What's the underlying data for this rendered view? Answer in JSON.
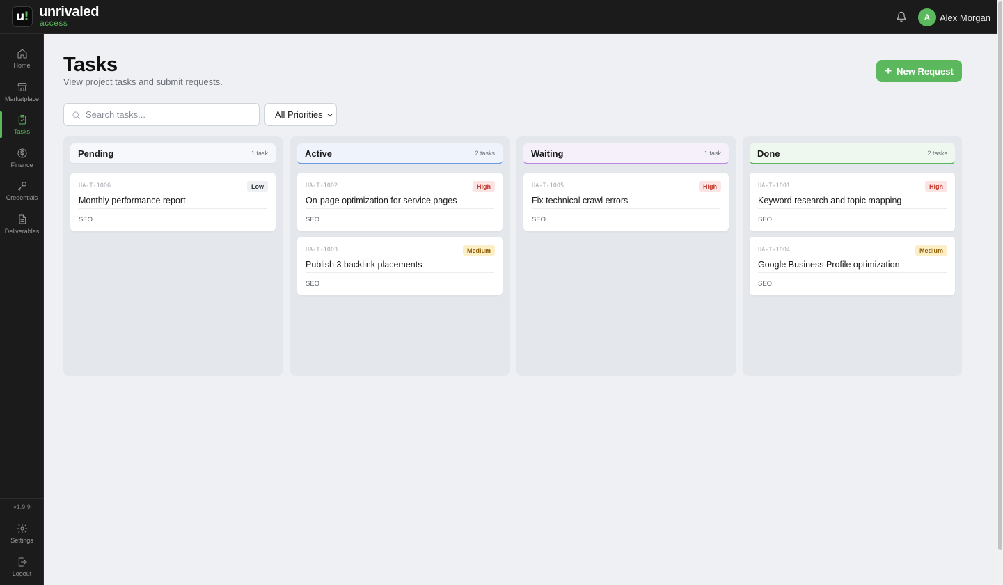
{
  "app": {
    "logo_mark": "u",
    "logo_mark_accent": "!",
    "name": "unrivaled",
    "sub": "access",
    "accent": "#5cb85c"
  },
  "user": {
    "initial": "A",
    "name": "Alex Morgan"
  },
  "sidebar": {
    "items": [
      {
        "label": "Home",
        "icon": "home-icon"
      },
      {
        "label": "Marketplace",
        "icon": "store-icon"
      },
      {
        "label": "Tasks",
        "icon": "clipboard-check-icon",
        "active": true
      },
      {
        "label": "Finance",
        "icon": "dollar-circle-icon"
      },
      {
        "label": "Credentials",
        "icon": "key-icon"
      },
      {
        "label": "Deliverables",
        "icon": "document-icon"
      }
    ],
    "version": "v1.9.9",
    "bottom": [
      {
        "label": "Settings",
        "icon": "gear-icon"
      },
      {
        "label": "Logout",
        "icon": "logout-icon"
      }
    ]
  },
  "page": {
    "title": "Tasks",
    "subtitle": "View project tasks and submit requests.",
    "new_request_label": "New Request"
  },
  "filters": {
    "search_placeholder": "Search tasks...",
    "priority_selected": "All Priorities"
  },
  "columns": [
    {
      "title": "Pending",
      "count": "1 task",
      "cards": [
        {
          "id": "UA-T-1006",
          "title": "Monthly performance report",
          "priority": "Low",
          "tag": "SEO"
        }
      ]
    },
    {
      "title": "Active",
      "count": "2 tasks",
      "cards": [
        {
          "id": "UA-T-1002",
          "title": "On-page optimization for service pages",
          "priority": "High",
          "tag": "SEO"
        },
        {
          "id": "UA-T-1003",
          "title": "Publish 3 backlink placements",
          "priority": "Medium",
          "tag": "SEO"
        }
      ]
    },
    {
      "title": "Waiting",
      "count": "1 task",
      "cards": [
        {
          "id": "UA-T-1005",
          "title": "Fix technical crawl errors",
          "priority": "High",
          "tag": "SEO"
        }
      ]
    },
    {
      "title": "Done",
      "count": "2 tasks",
      "cards": [
        {
          "id": "UA-T-1001",
          "title": "Keyword research and topic mapping",
          "priority": "High",
          "tag": "SEO"
        },
        {
          "id": "UA-T-1004",
          "title": "Google Business Profile optimization",
          "priority": "Medium",
          "tag": "SEO"
        }
      ]
    }
  ]
}
